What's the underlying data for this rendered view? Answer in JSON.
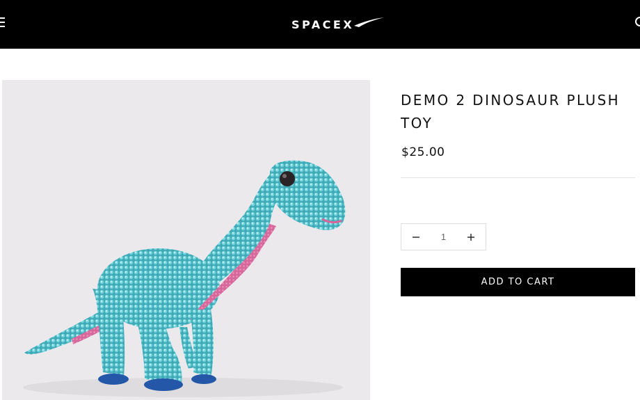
{
  "header": {
    "brand": "SPACEX",
    "menu_icon": "hamburger-menu-icon",
    "search_icon": "search-icon",
    "background": "#000000"
  },
  "product": {
    "image_alt": "Sequined dinosaur plush toy",
    "title": "DEMO 2 DINOSAUR PLUSH TOY",
    "price": "$25.00",
    "quantity": "1",
    "decrement_icon": "minus-icon",
    "increment_icon": "plus-icon",
    "add_to_cart_label": "ADD TO CART"
  },
  "colors": {
    "button_bg": "#000000",
    "button_text": "#ffffff",
    "image_bg": "#ece9ec",
    "sequin_teal": "#4bb8c4",
    "belly_pink": "#d86a9a"
  }
}
